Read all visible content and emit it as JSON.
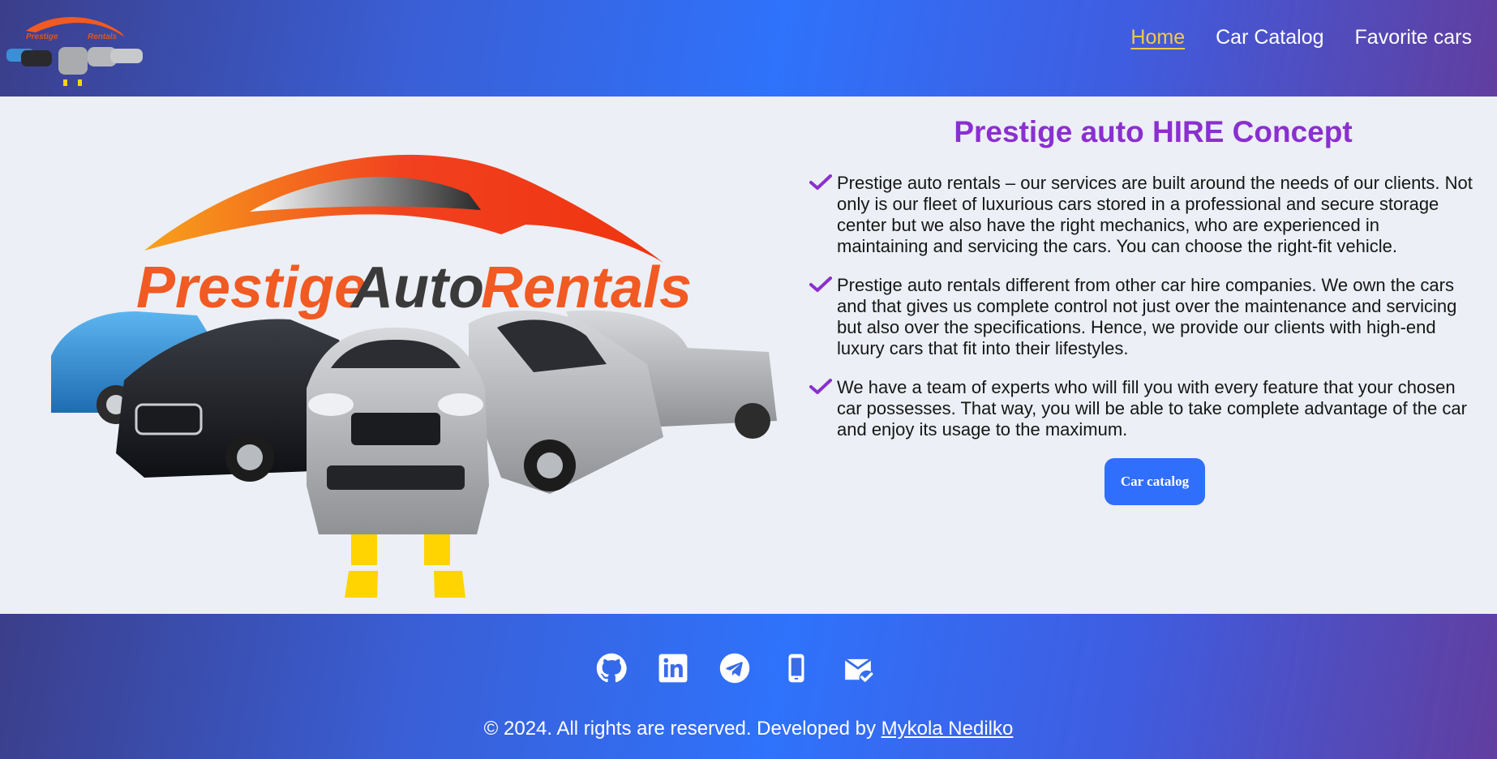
{
  "brand": {
    "logo_small_lines": [
      "Prestige",
      "Rentals"
    ],
    "logo_large_words": [
      "Prestige",
      "Auto",
      "Rentals"
    ]
  },
  "nav": {
    "items": [
      {
        "label": "Home",
        "active": true
      },
      {
        "label": "Car Catalog",
        "active": false
      },
      {
        "label": "Favorite cars",
        "active": false
      }
    ]
  },
  "main": {
    "title": "Prestige auto HIRE Concept",
    "paragraphs": [
      "Prestige auto rentals – our services are built around the needs of our clients. Not only is our fleet of luxurious cars stored in a professional and secure storage center but we also have the right mechanics, who are experienced in maintaining and servicing the cars. You can choose the right-fit vehicle.",
      "Prestige auto rentals different from other car hire companies. We own the cars and that gives us complete control not just over the maintenance and servicing but also over the specifications. Hence, we provide our clients with high-end luxury cars that fit into their lifestyles.",
      "We have a team of experts who will fill you with every feature that your chosen car possesses. That way, you will be able to take complete advantage of the car and enjoy its usage to the maximum."
    ],
    "button_label": "Car catalog"
  },
  "footer": {
    "social_icons": [
      "github-icon",
      "linkedin-icon",
      "telegram-icon",
      "phone-icon",
      "mail-icon"
    ],
    "copyright_text": "© 2024. All rights are reserved. Developed by ",
    "developer_name": "Mykola Nedilko"
  },
  "colors": {
    "accent_purple": "#8a2fd0",
    "button_blue": "#2f6ffb",
    "nav_active": "#f4c84a",
    "logo_orange": "#f15a22",
    "road_yellow": "#ffd400"
  }
}
